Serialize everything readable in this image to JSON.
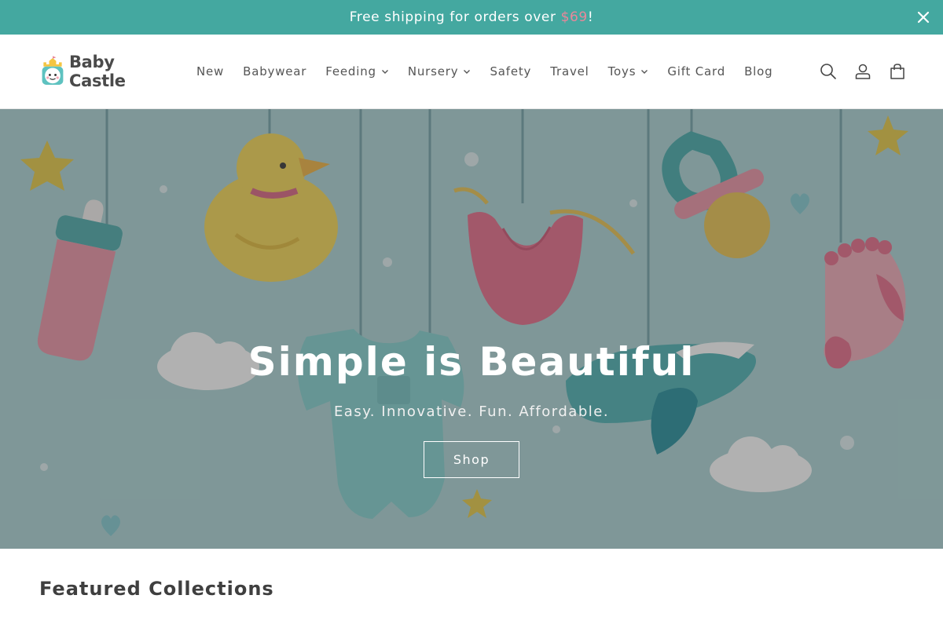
{
  "announcement": {
    "text_before": "Free shipping for orders over ",
    "price": "$69",
    "text_after": "!",
    "close_icon": "close-icon"
  },
  "header": {
    "logo_text": "Baby Castle",
    "nav": [
      {
        "label": "New",
        "dropdown": false
      },
      {
        "label": "Babywear",
        "dropdown": false
      },
      {
        "label": "Feeding",
        "dropdown": true
      },
      {
        "label": "Nursery",
        "dropdown": true
      },
      {
        "label": "Safety",
        "dropdown": false
      },
      {
        "label": "Travel",
        "dropdown": false
      },
      {
        "label": "Toys",
        "dropdown": true
      },
      {
        "label": "Gift Card",
        "dropdown": false
      },
      {
        "label": "Blog",
        "dropdown": false
      }
    ],
    "icons": [
      "search-icon",
      "account-icon",
      "cart-icon"
    ]
  },
  "hero": {
    "title": "Simple is Beautiful",
    "subtitle": "Easy. Innovative. Fun. Affordable.",
    "button_label": "Shop"
  },
  "featured": {
    "title": "Featured Collections"
  },
  "colors": {
    "announcement_bg": "#44a8a0",
    "price_accent": "#e9879a",
    "hero_bg": "#a9d3d4"
  }
}
